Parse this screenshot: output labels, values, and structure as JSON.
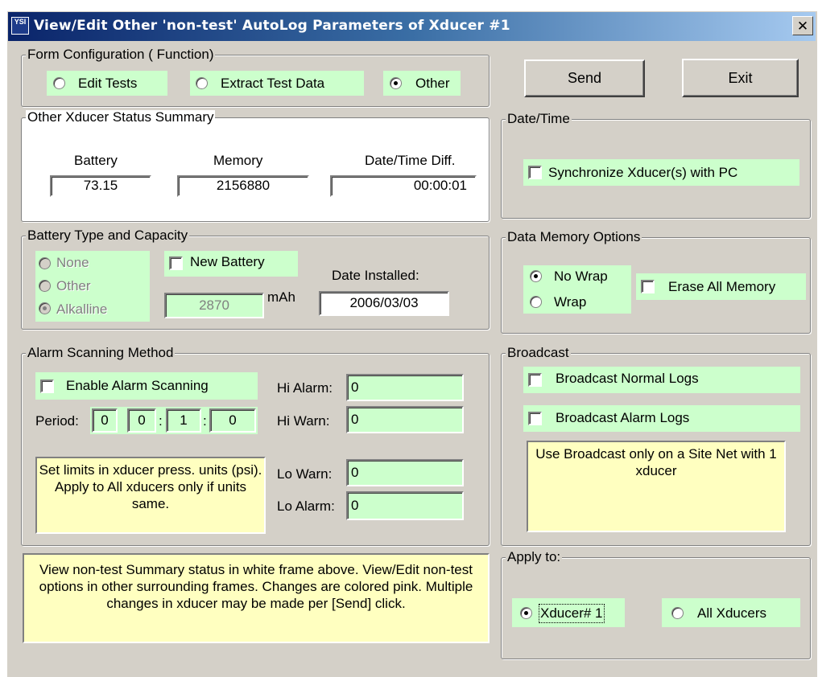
{
  "window": {
    "title": "View/Edit Other 'non-test' AutoLog Parameters of Xducer #1",
    "close_glyph": "✕",
    "icon_text": "YSI"
  },
  "form_config": {
    "legend": "Form Configuration ( Function)",
    "options": [
      {
        "label": "Edit Tests",
        "selected": false
      },
      {
        "label": "Extract Test Data",
        "selected": false
      },
      {
        "label": "Other",
        "selected": true
      }
    ]
  },
  "buttons": {
    "send": "Send",
    "exit": "Exit"
  },
  "status": {
    "legend": "Other Xducer Status Summary",
    "battery_label": "Battery",
    "battery_value": "73.15",
    "memory_label": "Memory",
    "memory_value": "2156880",
    "datetime_label": "Date/Time Diff.",
    "datetime_value": "00:00:01"
  },
  "datetime": {
    "legend": "Date/Time",
    "sync_label": "Synchronize Xducer(s) with PC",
    "sync_checked": false
  },
  "battery": {
    "legend": "Battery Type and Capacity",
    "types": [
      {
        "label": "None",
        "selected": false
      },
      {
        "label": "Other",
        "selected": false
      },
      {
        "label": "Alkalline",
        "selected": true
      }
    ],
    "new_battery_label": "New Battery",
    "capacity_value": "2870",
    "capacity_unit": "mAh",
    "date_installed_label": "Date Installed:",
    "date_installed_value": "2006/03/03"
  },
  "memory_options": {
    "legend": "Data Memory Options",
    "no_wrap_label": "No Wrap",
    "wrap_label": "Wrap",
    "wrap_selected": "No Wrap",
    "erase_label": "Erase All Memory"
  },
  "alarm": {
    "legend": "Alarm Scanning Method",
    "enable_label": "Enable Alarm Scanning",
    "period_label": "Period:",
    "period": [
      "0",
      "0",
      "1",
      "0"
    ],
    "period_sep": ":",
    "hi_alarm_label": "Hi Alarm:",
    "hi_alarm_value": "0",
    "hi_warn_label": "Hi Warn:",
    "hi_warn_value": "0",
    "lo_warn_label": "Lo Warn:",
    "lo_warn_value": "0",
    "lo_alarm_label": "Lo Alarm:",
    "lo_alarm_value": "0",
    "note": "Set limits in xducer press. units (psi). Apply to All xducers only if units same."
  },
  "broadcast": {
    "legend": "Broadcast",
    "normal_label": "Broadcast Normal Logs",
    "alarm_label": "Broadcast Alarm Logs",
    "note": "Use Broadcast only on a Site Net with 1 xducer"
  },
  "help_text": "View non-test Summary status in white frame above. View/Edit non-test options in other surrounding frames. Changes are colored pink.  Multiple changes in xducer may be made per [Send] click.",
  "apply_to": {
    "legend": "Apply to:",
    "xducer1_label": "Xducer# 1",
    "all_label": "All Xducers",
    "selected": "Xducer# 1"
  },
  "colors": {
    "window_bg": "#d4d0c8",
    "option_green": "#ccffcc",
    "note_yellow": "#ffffc0",
    "title_blue": "#0a246a"
  }
}
